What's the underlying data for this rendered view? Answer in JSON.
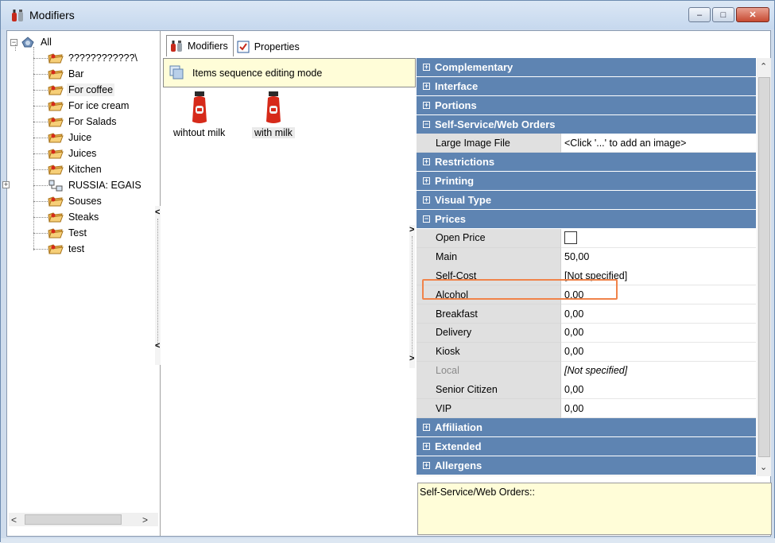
{
  "window": {
    "title": "Modifiers",
    "minimize": "–",
    "maximize": "□",
    "close": "✕"
  },
  "tree": {
    "root": "All",
    "items": [
      {
        "label": "????????????\\",
        "icon": "folder-icon"
      },
      {
        "label": "Bar",
        "icon": "folder-icon"
      },
      {
        "label": "For coffee",
        "icon": "folder-icon",
        "selected": true
      },
      {
        "label": "For ice cream",
        "icon": "folder-icon"
      },
      {
        "label": "For Salads",
        "icon": "folder-icon"
      },
      {
        "label": "Juice",
        "icon": "folder-icon"
      },
      {
        "label": "Juices",
        "icon": "folder-icon"
      },
      {
        "label": "Kitchen",
        "icon": "folder-icon"
      },
      {
        "label": "RUSSIA: EGAIS",
        "icon": "network-icon"
      },
      {
        "label": "Souses",
        "icon": "folder-icon"
      },
      {
        "label": "Steaks",
        "icon": "folder-icon"
      },
      {
        "label": "Test",
        "icon": "folder-icon"
      },
      {
        "label": "test",
        "icon": "folder-icon"
      }
    ]
  },
  "tabs": [
    {
      "label": "Modifiers",
      "active": true
    },
    {
      "label": "Properties",
      "active": false
    }
  ],
  "edit_mode": {
    "label": "Items sequence editing mode"
  },
  "items": [
    {
      "label": "wihtout milk"
    },
    {
      "label": "with milk",
      "selected": true
    }
  ],
  "property_grid": {
    "rows": [
      {
        "type": "category",
        "label": "Complementary",
        "expanded": false
      },
      {
        "type": "category",
        "label": "Interface",
        "expanded": false
      },
      {
        "type": "category",
        "label": "Portions",
        "expanded": false
      },
      {
        "type": "category",
        "label": "Self-Service/Web Orders",
        "expanded": true
      },
      {
        "type": "property",
        "name": "Large Image File",
        "value": "<Click '...' to add an image>"
      },
      {
        "type": "category",
        "label": "Restrictions",
        "expanded": false
      },
      {
        "type": "category",
        "label": "Printing",
        "expanded": false
      },
      {
        "type": "category",
        "label": "Visual Type",
        "expanded": false
      },
      {
        "type": "category",
        "label": "Prices",
        "expanded": true
      },
      {
        "type": "property",
        "name": "Open Price",
        "value": "",
        "checkbox": true
      },
      {
        "type": "property",
        "name": "Main",
        "value": "50,00"
      },
      {
        "type": "property",
        "name": "Self-Cost",
        "value": "[Not specified]"
      },
      {
        "type": "property",
        "name": "Alcohol",
        "value": "0,00"
      },
      {
        "type": "property",
        "name": "Breakfast",
        "value": "0,00"
      },
      {
        "type": "property",
        "name": "Delivery",
        "value": "0,00"
      },
      {
        "type": "property",
        "name": "Kiosk",
        "value": "0,00"
      },
      {
        "type": "property",
        "name": "Local",
        "value": "[Not specified]",
        "disabled": true
      },
      {
        "type": "property",
        "name": "Senior Citizen",
        "value": "0,00"
      },
      {
        "type": "property",
        "name": "VIP",
        "value": "0,00"
      },
      {
        "type": "category",
        "label": "Affiliation",
        "expanded": false
      },
      {
        "type": "category",
        "label": "Extended",
        "expanded": false
      },
      {
        "type": "category",
        "label": "Allergens",
        "expanded": false
      }
    ]
  },
  "description": {
    "text": "Self-Service/Web Orders::"
  },
  "colors": {
    "category_bg": "#5e84b2",
    "highlight": "#f0834a",
    "info_bg": "#fffdd8"
  }
}
